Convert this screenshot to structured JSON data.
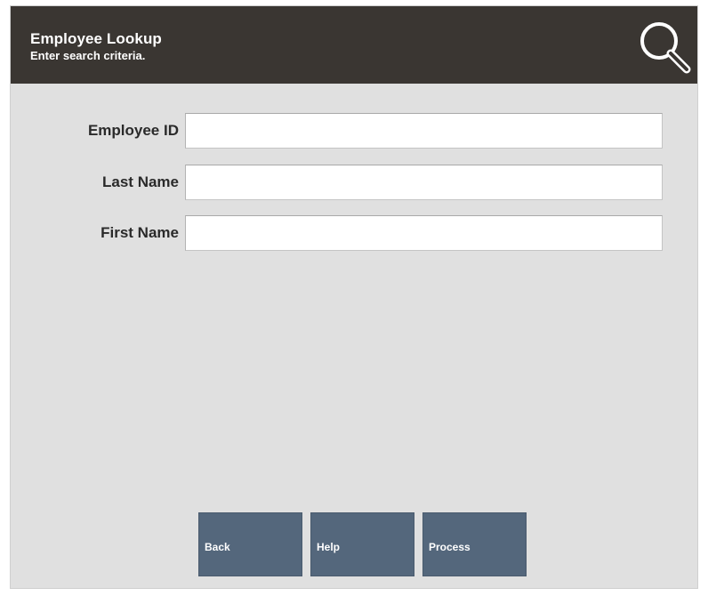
{
  "header": {
    "title": "Employee Lookup",
    "subtitle": "Enter search criteria.",
    "icon": "search-icon"
  },
  "form": {
    "fields": [
      {
        "label": "Employee ID",
        "value": "",
        "placeholder": ""
      },
      {
        "label": "Last Name",
        "value": "",
        "placeholder": ""
      },
      {
        "label": "First Name",
        "value": "",
        "placeholder": ""
      }
    ]
  },
  "buttons": {
    "back": "Back",
    "help": "Help",
    "process": "Process"
  },
  "colors": {
    "header_bg": "#3a3632",
    "panel_bg": "#e0e0e0",
    "button_bg": "#54677c"
  }
}
